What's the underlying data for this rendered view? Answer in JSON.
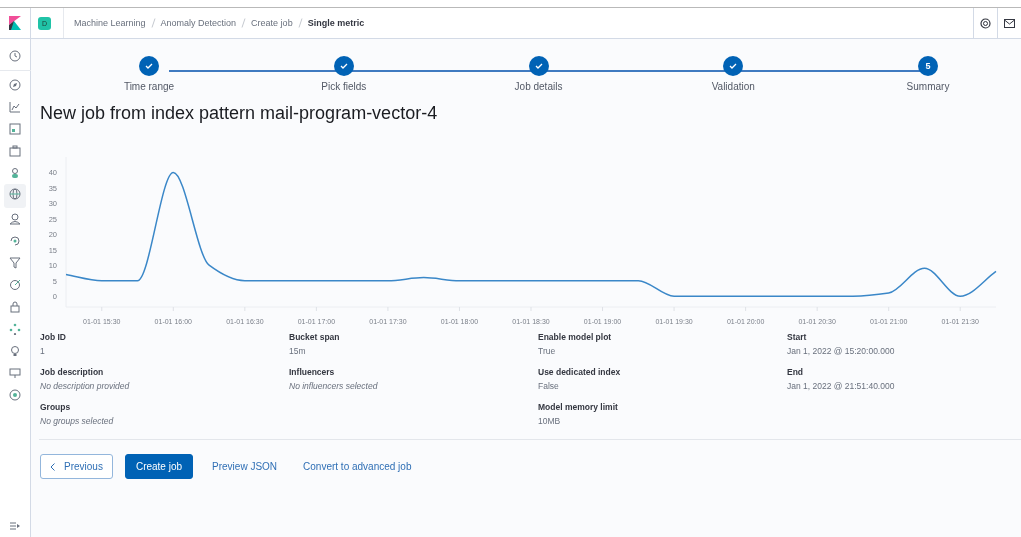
{
  "header": {
    "space_initial": "D",
    "breadcrumbs": [
      {
        "label": "Machine Learning",
        "current": false
      },
      {
        "label": "Anomaly Detection",
        "current": false
      },
      {
        "label": "Create job",
        "current": false
      },
      {
        "label": "Single metric",
        "current": true
      }
    ]
  },
  "steps": [
    {
      "label": "Time range",
      "complete": true
    },
    {
      "label": "Pick fields",
      "complete": true
    },
    {
      "label": "Job details",
      "complete": true
    },
    {
      "label": "Validation",
      "complete": true
    },
    {
      "label": "Summary",
      "complete": false,
      "number": "5"
    }
  ],
  "title": "New job from index pattern mail-program-vector-4",
  "chart_data": {
    "type": "line",
    "categories": [
      null,
      "01-01 15:30",
      null,
      "01-01 16:00",
      null,
      "01-01 16:30",
      null,
      "01-01 17:00",
      null,
      "01-01 17:30",
      null,
      "01-01 18:00",
      null,
      "01-01 18:30",
      null,
      "01-01 19:00",
      null,
      "01-01 19:30",
      null,
      "01-01 20:00",
      null,
      "01-01 20:30",
      null,
      "01-01 21:00",
      null,
      "01-01 21:30",
      null
    ],
    "series": [
      {
        "color": "#3a87c8",
        "values": [
          7,
          5,
          5,
          40,
          10,
          5,
          5,
          5,
          5,
          5,
          6,
          5,
          5,
          5,
          5,
          5,
          5,
          0,
          0,
          0,
          0,
          0,
          0,
          1,
          9,
          0,
          8
        ]
      }
    ],
    "ylim": [
      -3.5,
      45
    ],
    "yticks": [
      0,
      5,
      10,
      15,
      20,
      25,
      30,
      35,
      40
    ]
  },
  "summary": [
    [
      {
        "label": "Job ID",
        "value": "1",
        "empty": false
      },
      {
        "label": "Job description",
        "value": "No description provided",
        "empty": true
      },
      {
        "label": "Groups",
        "value": "No groups selected",
        "empty": true
      }
    ],
    [
      {
        "label": "Bucket span",
        "value": "15m",
        "empty": false
      },
      {
        "label": "Influencers",
        "value": "No influencers selected",
        "empty": true
      }
    ],
    [
      {
        "label": "Enable model plot",
        "value": "True",
        "empty": false
      },
      {
        "label": "Use dedicated index",
        "value": "False",
        "empty": false
      },
      {
        "label": "Model memory limit",
        "value": "10MB",
        "empty": false
      }
    ],
    [
      {
        "label": "Start",
        "value": "Jan 1, 2022 @ 15:20:00.000",
        "empty": false
      },
      {
        "label": "End",
        "value": "Jan 1, 2022 @ 21:51:40.000",
        "empty": false
      }
    ]
  ],
  "actions": [
    {
      "kind": "back",
      "label": "Previous"
    },
    {
      "kind": "primary",
      "label": "Create job"
    },
    {
      "kind": "link",
      "label": "Preview JSON"
    },
    {
      "kind": "link",
      "label": "Convert to advanced job"
    }
  ]
}
